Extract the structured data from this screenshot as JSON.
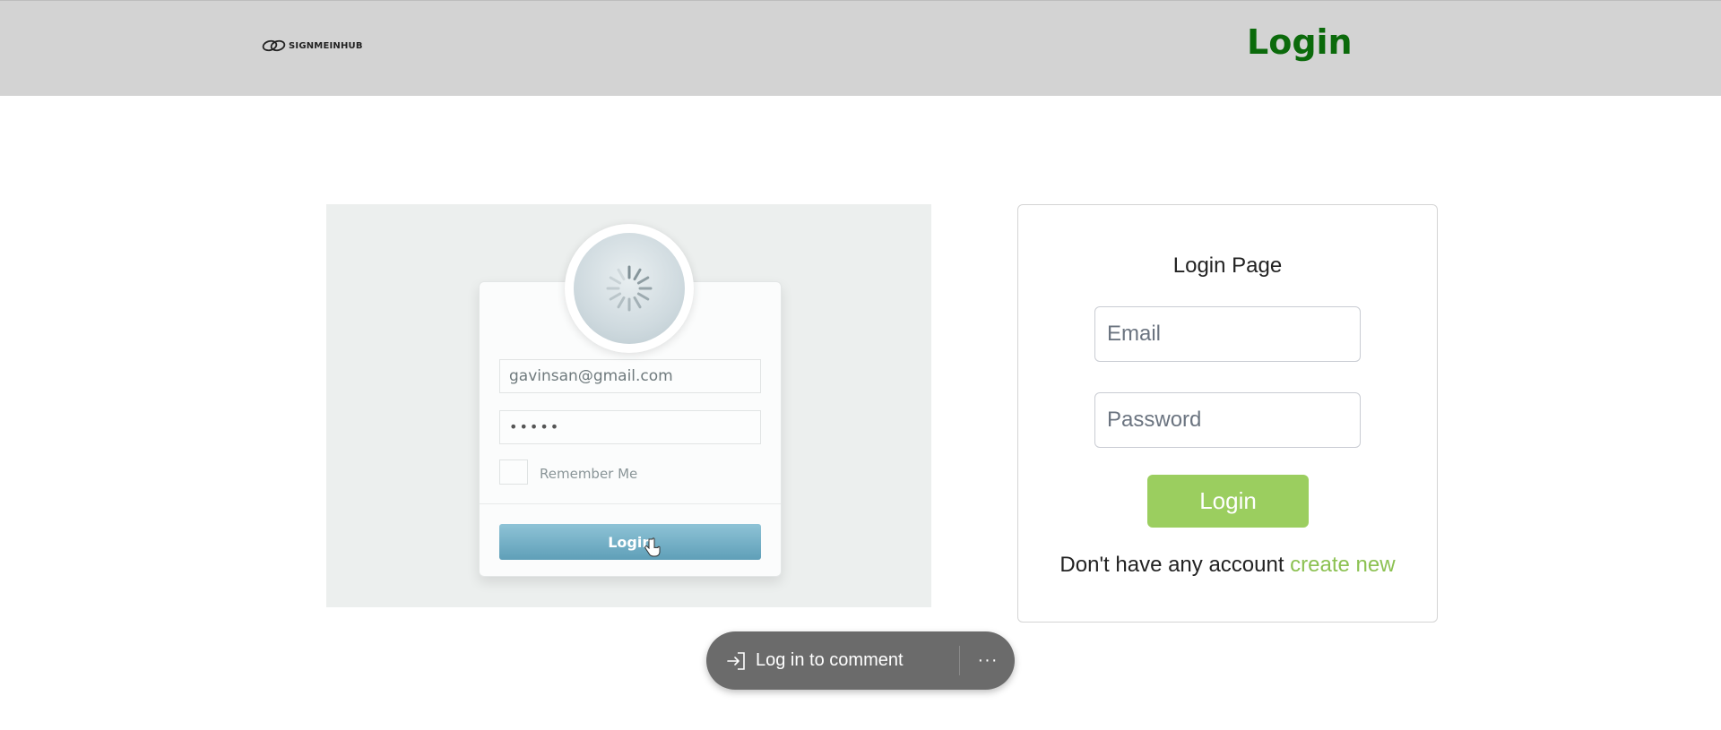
{
  "header": {
    "logo_text": "SIGNMEINHUB",
    "title": "Login",
    "title_color": "#0b6a0b",
    "background": "#d3d3d3"
  },
  "illustration": {
    "email_value": "gavinsan@gmail.com",
    "password_value": "•••••",
    "remember_label": "Remember Me",
    "button_label": "Login"
  },
  "login_form": {
    "heading": "Login Page",
    "email_placeholder": "Email",
    "password_placeholder": "Password",
    "submit_label": "Login",
    "submit_color": "#9bce5f",
    "signup_prompt": "Don't have any account",
    "signup_link": "create new",
    "link_color": "#8cc152"
  },
  "comment_bar": {
    "label": "Log in to comment",
    "more_label": "···",
    "icons": [
      "sign-in-icon",
      "more-icon"
    ]
  }
}
